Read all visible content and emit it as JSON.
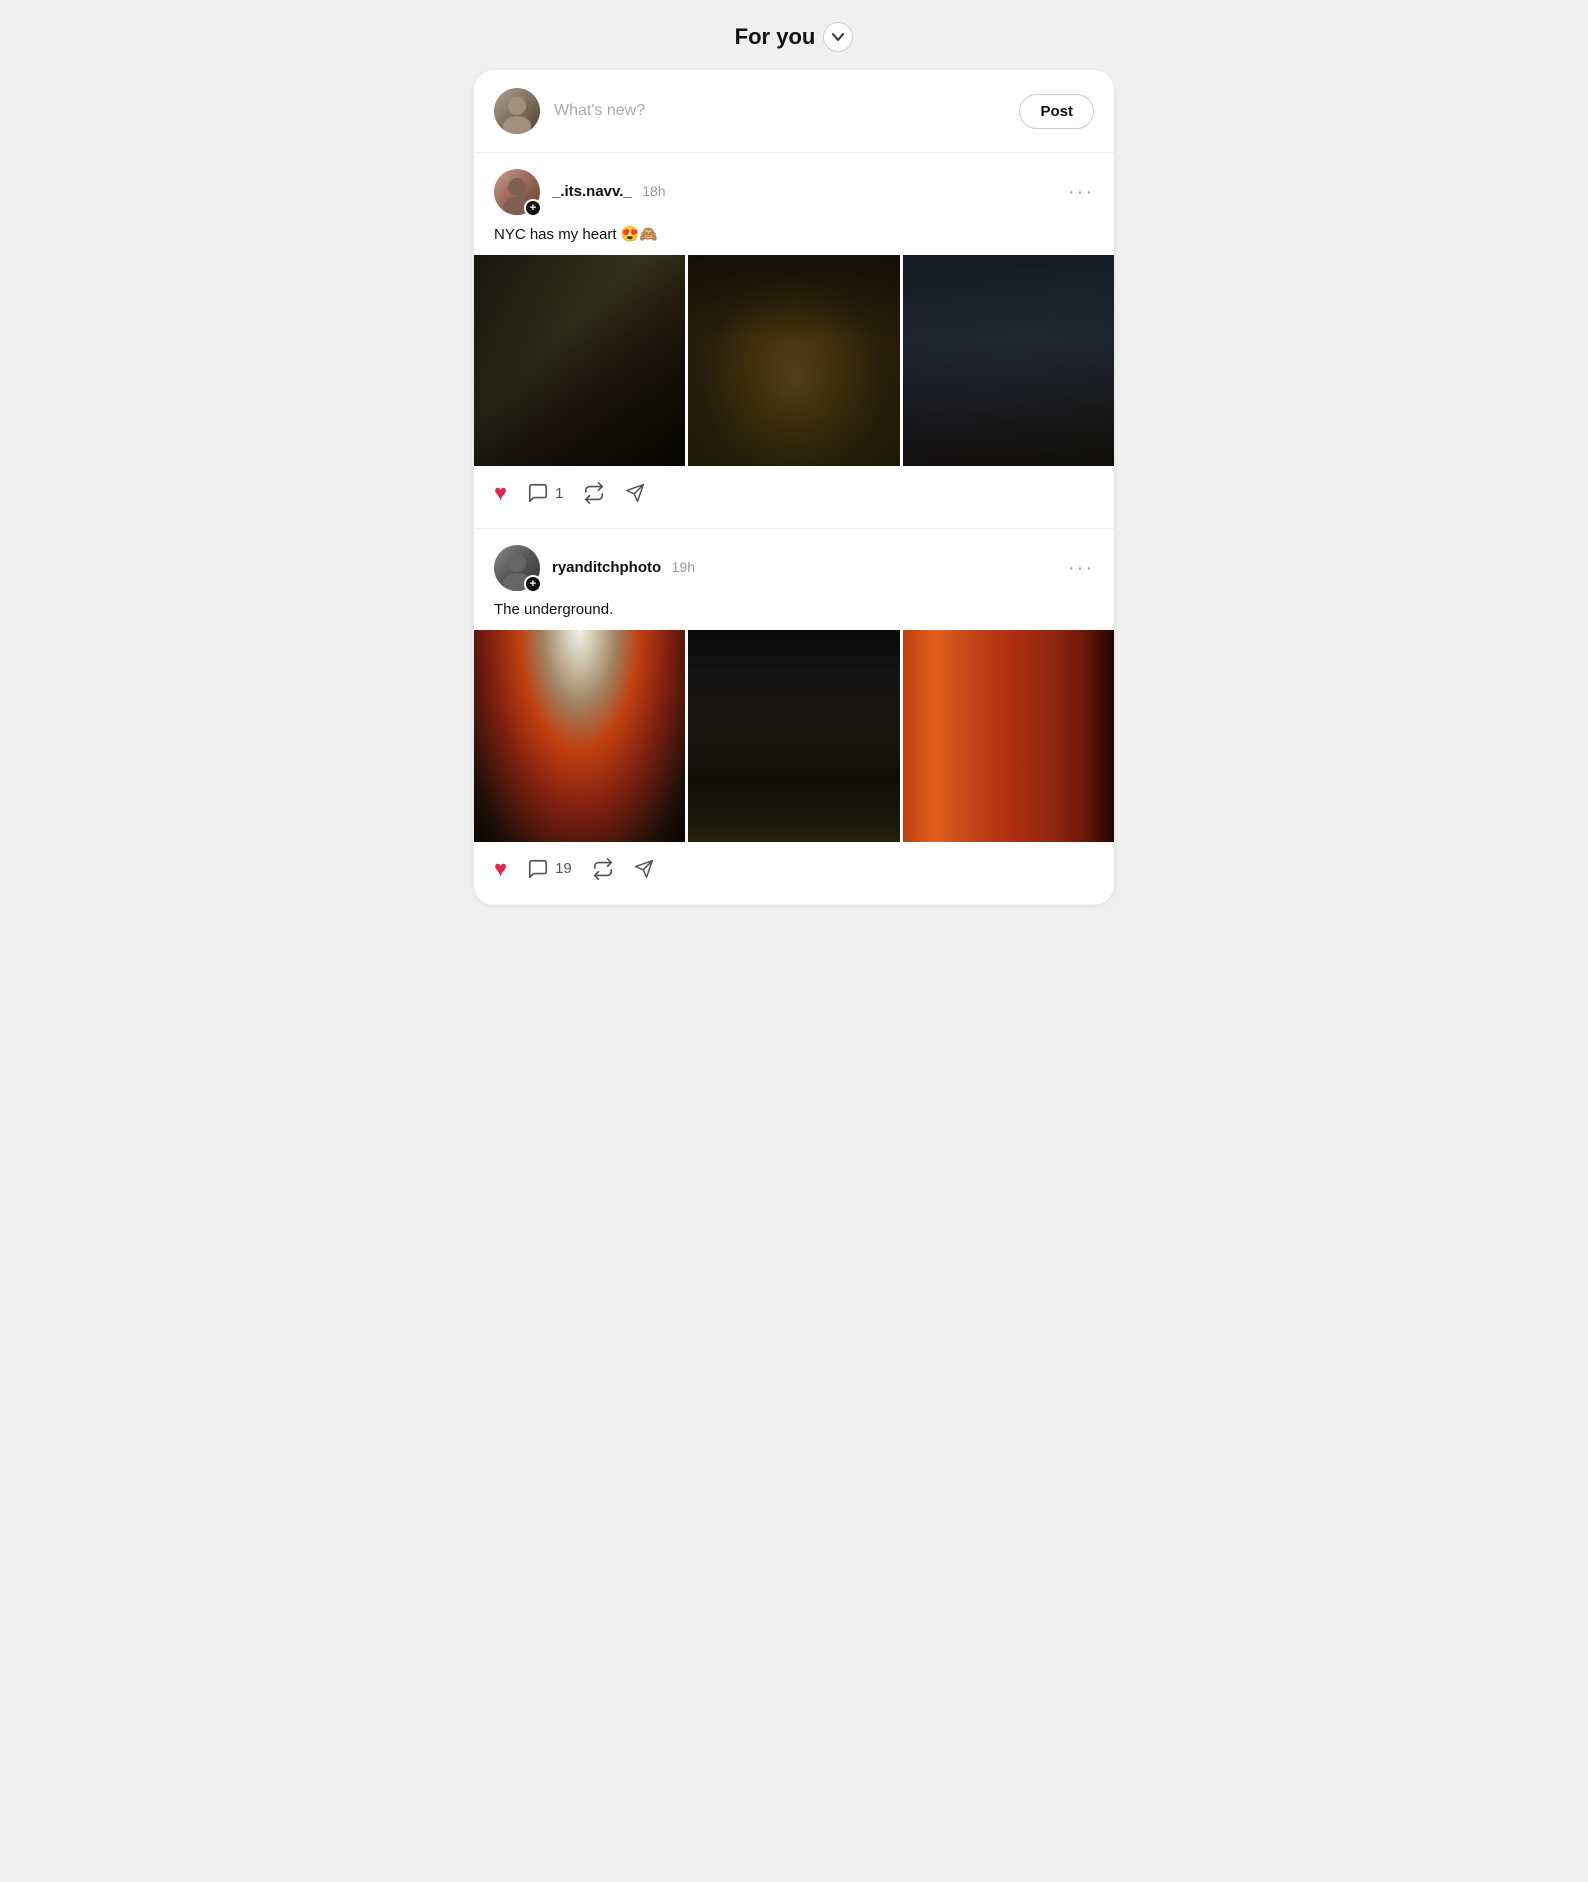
{
  "header": {
    "title": "For you",
    "chevron_label": "dropdown"
  },
  "compose": {
    "placeholder": "What's new?",
    "post_label": "Post"
  },
  "posts": [
    {
      "id": "post-1",
      "username": "_.its.navv._",
      "time": "18h",
      "caption": "NYC has my heart 😍🙈",
      "actions": {
        "liked": true,
        "comment_count": "1",
        "repost_count": "",
        "share_count": ""
      },
      "photos": [
        {
          "id": "nyc-1",
          "alt": "NYC street restaurant night"
        },
        {
          "id": "nyc-2",
          "alt": "NYC foggy skyline night"
        },
        {
          "id": "nyc-3",
          "alt": "NYC Fifth Ave rainy night"
        }
      ]
    },
    {
      "id": "post-2",
      "username": "ryanditchphoto",
      "time": "19h",
      "caption": "The underground.",
      "actions": {
        "liked": true,
        "comment_count": "19",
        "repost_count": "",
        "share_count": ""
      },
      "photos": [
        {
          "id": "und-1",
          "alt": "Underground escalator red tubes"
        },
        {
          "id": "und-2",
          "alt": "Baker Street station exterior"
        },
        {
          "id": "und-3",
          "alt": "Underground tunnel orange"
        }
      ]
    }
  ]
}
